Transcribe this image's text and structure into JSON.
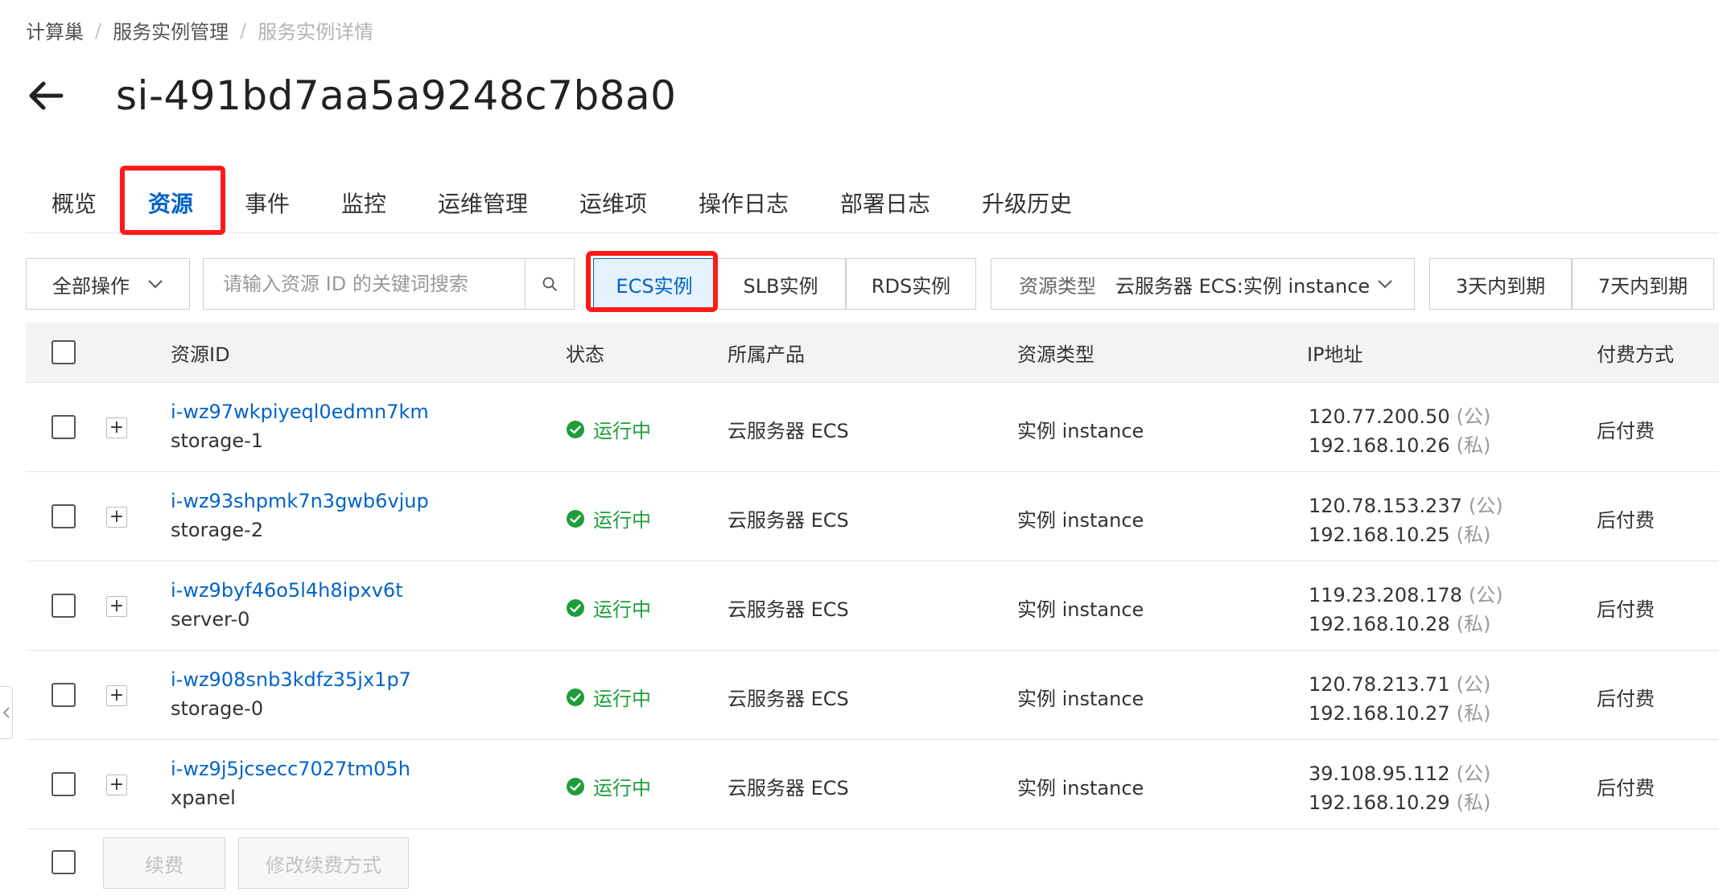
{
  "breadcrumb": [
    "计算巢",
    "服务实例管理",
    "服务实例详情"
  ],
  "breadcrumb_separator": "/",
  "page": {
    "title": "si-491bd7aa5a9248c7b8a0"
  },
  "tabs": [
    "概览",
    "资源",
    "事件",
    "监控",
    "运维管理",
    "运维项",
    "操作日志",
    "部署日志",
    "升级历史"
  ],
  "active_tab": "资源",
  "toolbar": {
    "bulk_label": "全部操作",
    "search_placeholder": "请输入资源 ID 的关键词搜索",
    "segments": [
      "ECS实例",
      "SLB实例",
      "RDS实例"
    ],
    "active_segment": "ECS实例",
    "filter_label": "资源类型",
    "filter_value": "云服务器 ECS:实例 instance",
    "expire_3": "3天内到期",
    "expire_7": "7天内到期"
  },
  "table": {
    "headers": [
      "资源ID",
      "状态",
      "所属产品",
      "资源类型",
      "IP地址",
      "付费方式"
    ],
    "rows": [
      {
        "id": "i-wz97wkpiyeql0edmn7km",
        "name": "storage-1",
        "status": "运行中",
        "product": "云服务器 ECS",
        "type": "实例 instance",
        "ip_public": "120.77.200.50",
        "ip_private": "192.168.10.26",
        "billing": "后付费"
      },
      {
        "id": "i-wz93shpmk7n3gwb6vjup",
        "name": "storage-2",
        "status": "运行中",
        "product": "云服务器 ECS",
        "type": "实例 instance",
        "ip_public": "120.78.153.237",
        "ip_private": "192.168.10.25",
        "billing": "后付费"
      },
      {
        "id": "i-wz9byf46o5l4h8ipxv6t",
        "name": "server-0",
        "status": "运行中",
        "product": "云服务器 ECS",
        "type": "实例 instance",
        "ip_public": "119.23.208.178",
        "ip_private": "192.168.10.28",
        "billing": "后付费"
      },
      {
        "id": "i-wz908snb3kdfz35jx1p7",
        "name": "storage-0",
        "status": "运行中",
        "product": "云服务器 ECS",
        "type": "实例 instance",
        "ip_public": "120.78.213.71",
        "ip_private": "192.168.10.27",
        "billing": "后付费"
      },
      {
        "id": "i-wz9j5jcsecc7027tm05h",
        "name": "xpanel",
        "status": "运行中",
        "product": "云服务器 ECS",
        "type": "实例 instance",
        "ip_public": "39.108.95.112",
        "ip_private": "192.168.10.29",
        "billing": "后付费"
      }
    ],
    "ip_public_tag": "(公)",
    "ip_private_tag": "(私)"
  },
  "footer": {
    "renew_label": "续费",
    "change_billing_label": "修改续费方式"
  },
  "colors": {
    "accent": "#0064c8",
    "highlight": "#ff1a1a",
    "status_running": "#1e9e3a",
    "header_bg": "#f2f3f5"
  },
  "icons": [
    "back-arrow-icon",
    "chevron-down-icon",
    "search-icon",
    "check-circle-icon",
    "plus-icon",
    "chevron-left-icon"
  ]
}
